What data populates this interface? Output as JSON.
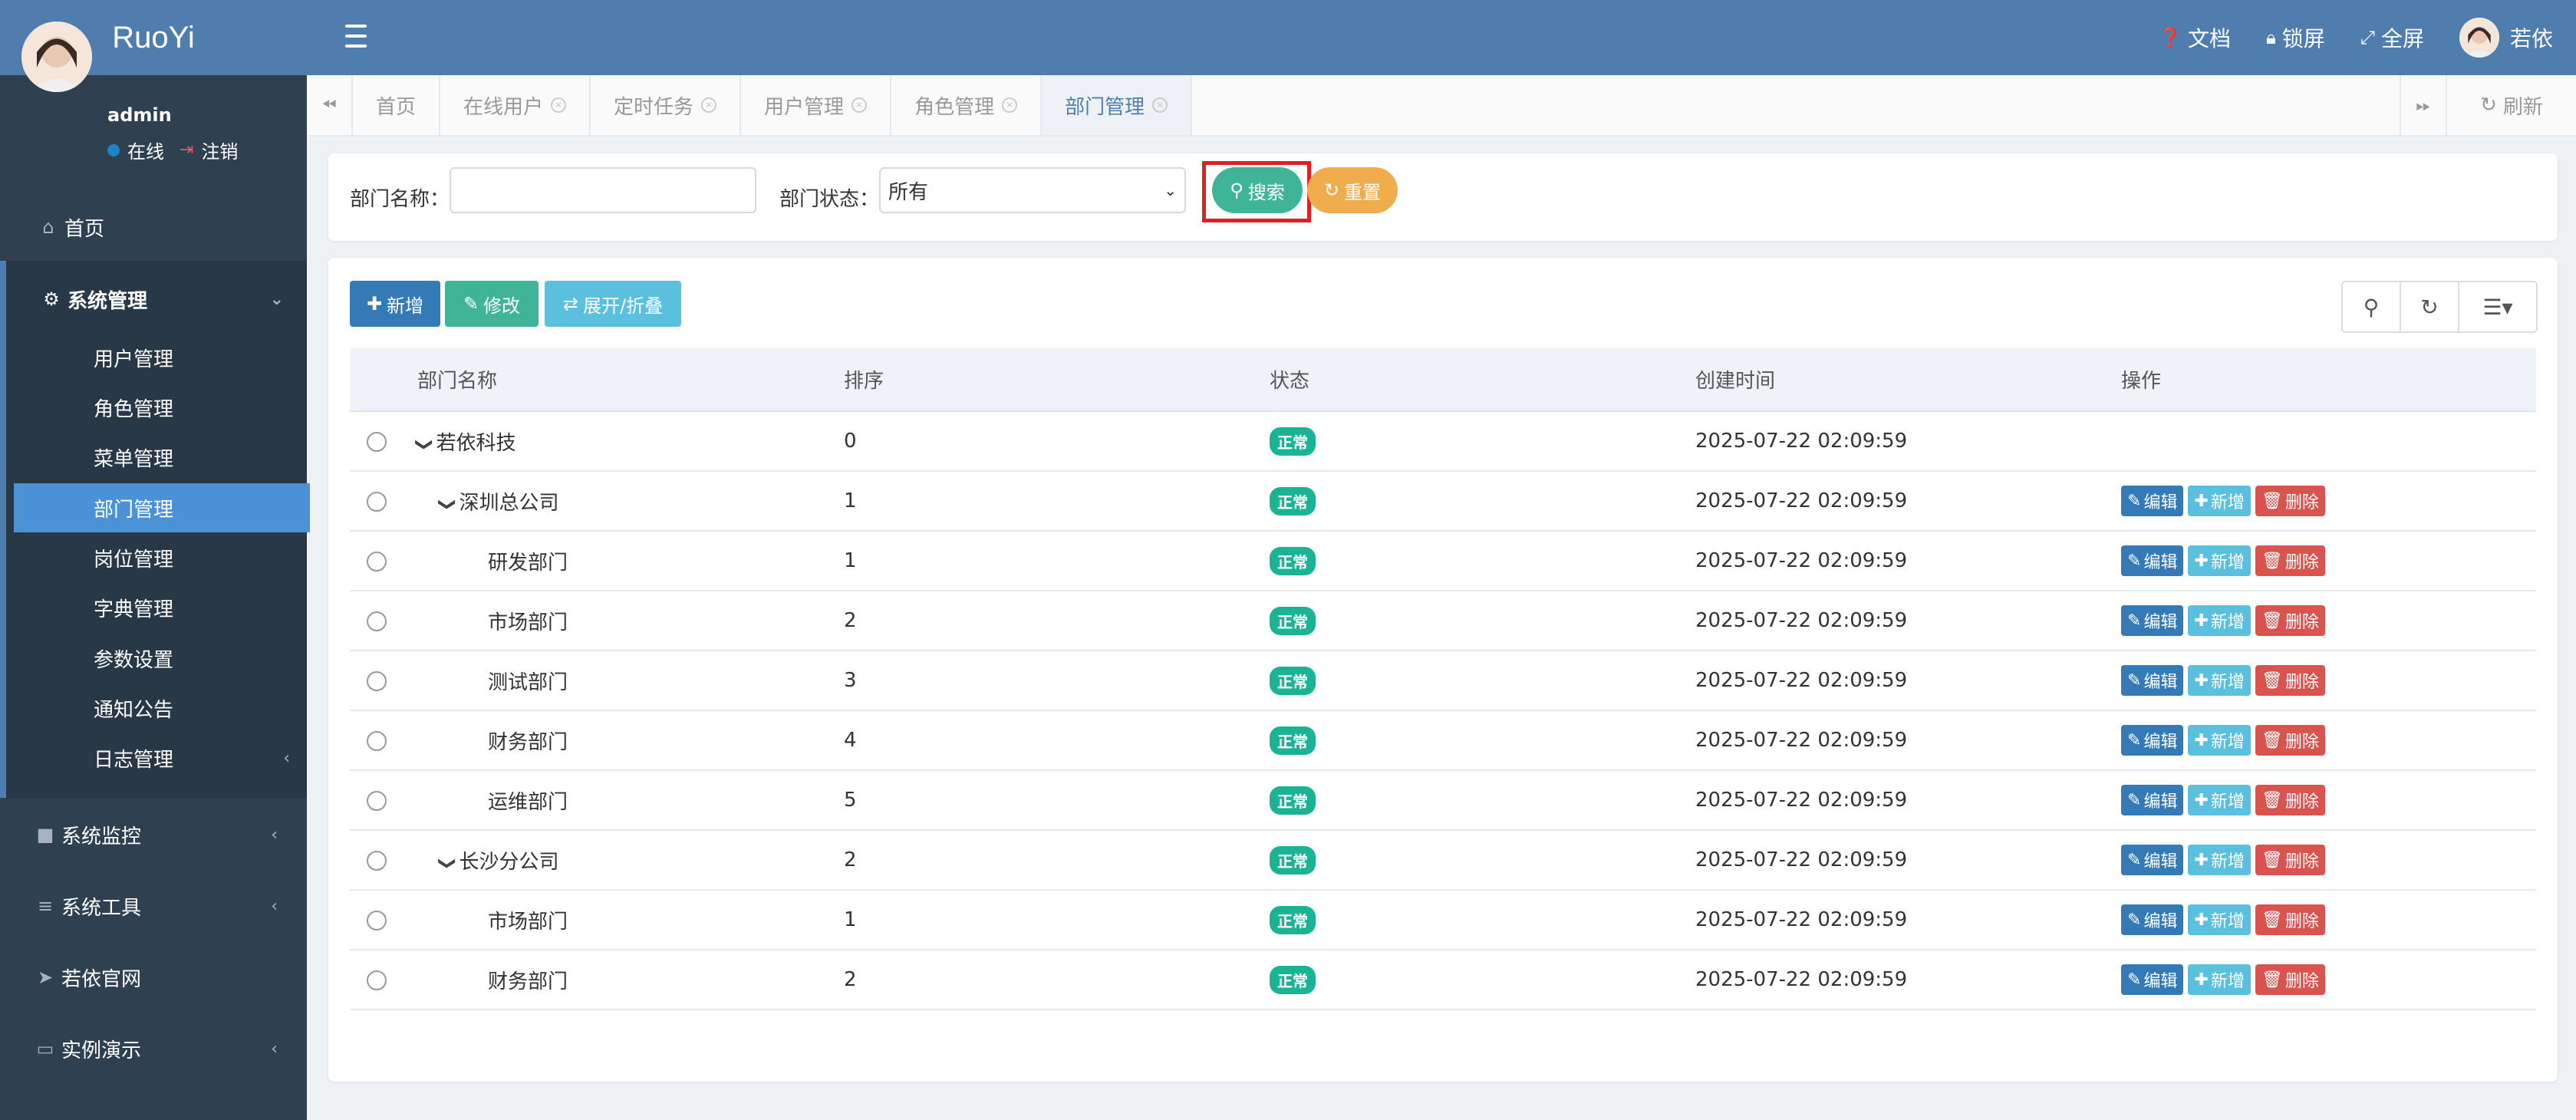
{
  "app": {
    "logo": "RuoYi"
  },
  "user_panel": {
    "name": "admin",
    "status_online": "在线",
    "logout": "注销"
  },
  "sidebar": {
    "home": "首页",
    "system_mgmt": "系统管理",
    "sub_items": [
      {
        "label": "用户管理"
      },
      {
        "label": "角色管理"
      },
      {
        "label": "菜单管理"
      },
      {
        "label": "部门管理"
      },
      {
        "label": "岗位管理"
      },
      {
        "label": "字典管理"
      },
      {
        "label": "参数设置"
      },
      {
        "label": "通知公告"
      },
      {
        "label": "日志管理"
      }
    ],
    "monitor": "系统监控",
    "tools": "系统工具",
    "official": "若依官网",
    "demo": "实例演示"
  },
  "topbar": {
    "docs": "文档",
    "lock": "锁屏",
    "fullscreen": "全屏",
    "user": "若依"
  },
  "tabs": [
    {
      "label": "首页"
    },
    {
      "label": "在线用户"
    },
    {
      "label": "定时任务"
    },
    {
      "label": "用户管理"
    },
    {
      "label": "角色管理"
    },
    {
      "label": "部门管理"
    }
  ],
  "refresh": "刷新",
  "search": {
    "dept_name_label": "部门名称：",
    "dept_name_value": "",
    "dept_status_label": "部门状态：",
    "dept_status_value": "所有",
    "search_btn": "搜索",
    "reset_btn": "重置"
  },
  "toolbar": {
    "add": "新增",
    "edit": "修改",
    "toggle": "展开/折叠"
  },
  "table": {
    "headers": [
      "部门名称",
      "排序",
      "状态",
      "创建时间",
      "操作"
    ],
    "op_labels": {
      "edit": "编辑",
      "add": "新增",
      "del": "删除"
    },
    "rows": [
      {
        "name": "若依科技",
        "order": "0",
        "status": "正常",
        "created": "2025-07-22 02:09:59"
      },
      {
        "name": "深圳总公司",
        "order": "1",
        "status": "正常",
        "created": "2025-07-22 02:09:59"
      },
      {
        "name": "研发部门",
        "order": "1",
        "status": "正常",
        "created": "2025-07-22 02:09:59"
      },
      {
        "name": "市场部门",
        "order": "2",
        "status": "正常",
        "created": "2025-07-22 02:09:59"
      },
      {
        "name": "测试部门",
        "order": "3",
        "status": "正常",
        "created": "2025-07-22 02:09:59"
      },
      {
        "name": "财务部门",
        "order": "4",
        "status": "正常",
        "created": "2025-07-22 02:09:59"
      },
      {
        "name": "运维部门",
        "order": "5",
        "status": "正常",
        "created": "2025-07-22 02:09:59"
      },
      {
        "name": "长沙分公司",
        "order": "2",
        "status": "正常",
        "created": "2025-07-22 02:09:59"
      },
      {
        "name": "市场部门",
        "order": "1",
        "status": "正常",
        "created": "2025-07-22 02:09:59"
      },
      {
        "name": "财务部门",
        "order": "2",
        "status": "正常",
        "created": "2025-07-22 02:09:59"
      }
    ]
  },
  "colors": {
    "sidebar": "#2f4050",
    "topbar": "#4f7eae",
    "active": "#4b91d6",
    "search": "#3fb497",
    "reset": "#f0ad4e",
    "badge": "#1ab394"
  }
}
